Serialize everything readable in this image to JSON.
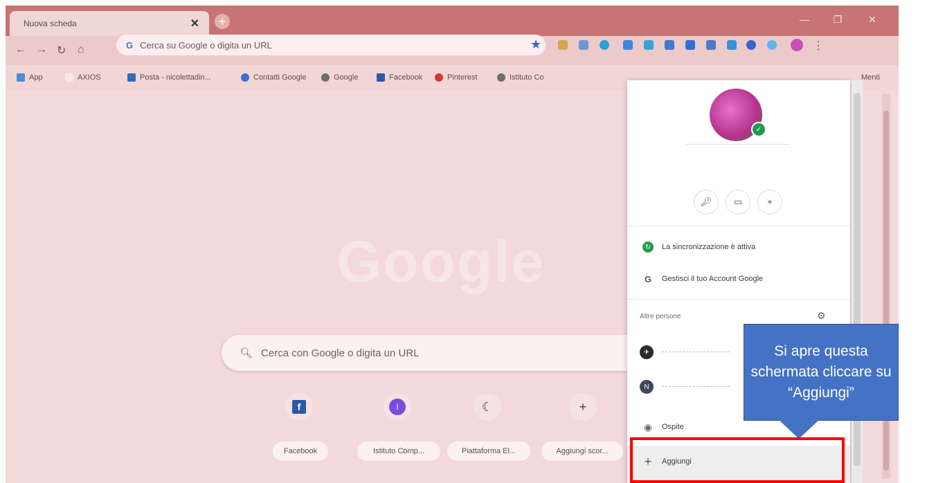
{
  "tab": {
    "title": "Nuova scheda"
  },
  "omnibox": {
    "g_icon": "G",
    "placeholder": "Cerca su Google o digita un URL"
  },
  "bookmarks": [
    {
      "label": "App"
    },
    {
      "label": "AXIOS"
    },
    {
      "label": "Posta - nicolettadin..."
    },
    {
      "label": "Contatti Google"
    },
    {
      "label": "Google"
    },
    {
      "label": "Facebook"
    },
    {
      "label": "Pinterest"
    },
    {
      "label": "Istituto Co"
    }
  ],
  "bookmarks_overflow": "Menti",
  "newtab": {
    "logo": "Google",
    "search_placeholder": "Cerca con Google o digita un URL",
    "shortcuts": [
      {
        "icon": "f",
        "label": "Facebook"
      },
      {
        "icon": "I",
        "label": "Istituto Comp..."
      },
      {
        "icon": "☾",
        "label": "Piattaforma El..."
      },
      {
        "icon": "+",
        "label": "Aggiungi scor..."
      }
    ]
  },
  "profile_menu": {
    "sync_label": "La sincronizzazione è attiva",
    "manage_account_label": "Gestisci il tuo Account Google",
    "other_people_label": "Altre persone",
    "guest_label": "Ospite",
    "add_label": "Aggiungi",
    "person2_initial": "N"
  },
  "callout": {
    "text": "Si apre questa schermata cliccare su “Aggiungi”"
  },
  "colors": {
    "accent": "#4472c4",
    "highlight": "#ff0000"
  }
}
